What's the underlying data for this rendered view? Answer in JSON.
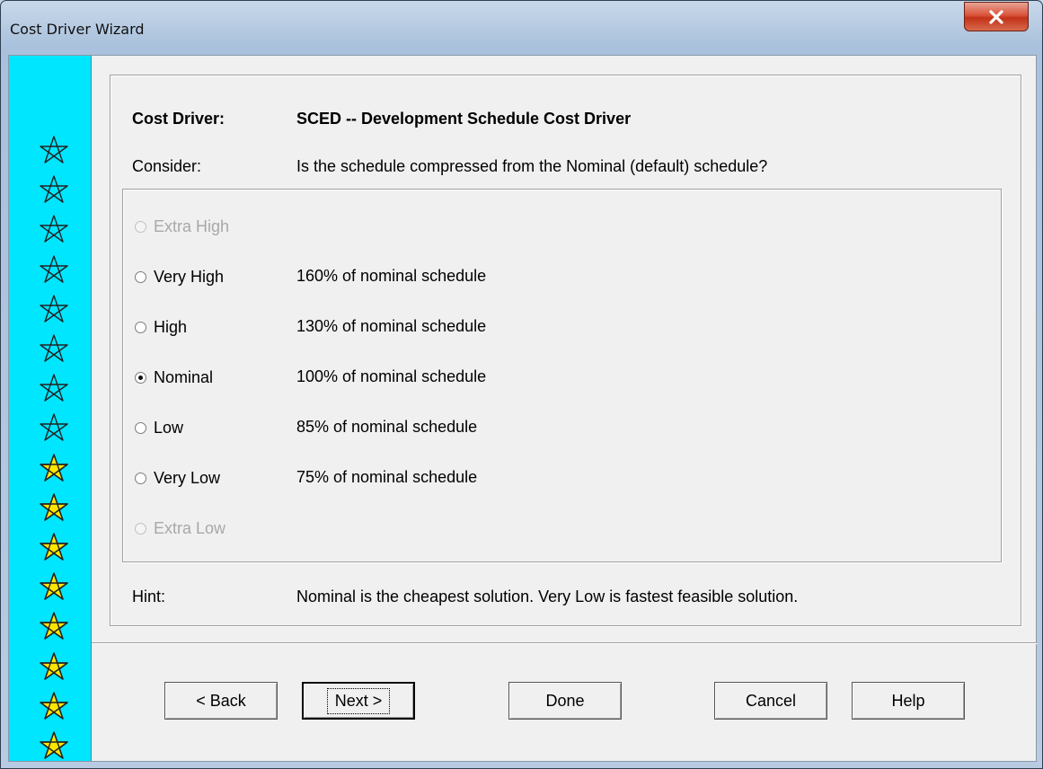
{
  "window": {
    "title": "Cost Driver Wizard"
  },
  "stars": {
    "outline_count": 8,
    "filled_count": 8,
    "outline_color": "#00e6ff",
    "filled_color": "#ffe600"
  },
  "header": {
    "driver_label": "Cost Driver:",
    "driver_value": "SCED -- Development Schedule Cost Driver",
    "consider_label": "Consider:",
    "consider_value": "Is the schedule compressed from the Nominal (default) schedule?"
  },
  "options": [
    {
      "label": "Extra High",
      "desc": "",
      "enabled": false,
      "checked": false
    },
    {
      "label": "Very High",
      "desc": "160% of nominal schedule",
      "enabled": true,
      "checked": false
    },
    {
      "label": "High",
      "desc": "130% of nominal schedule",
      "enabled": true,
      "checked": false
    },
    {
      "label": "Nominal",
      "desc": "100% of nominal schedule",
      "enabled": true,
      "checked": true
    },
    {
      "label": "Low",
      "desc": "85% of nominal schedule",
      "enabled": true,
      "checked": false
    },
    {
      "label": "Very Low",
      "desc": "75% of nominal schedule",
      "enabled": true,
      "checked": false
    },
    {
      "label": "Extra Low",
      "desc": "",
      "enabled": false,
      "checked": false
    }
  ],
  "hint": {
    "label": "Hint:",
    "value": "Nominal is the cheapest solution.  Very Low is fastest feasible solution."
  },
  "buttons": {
    "back": "< Back",
    "next": "Next >",
    "done": "Done",
    "cancel": "Cancel",
    "help": "Help"
  }
}
